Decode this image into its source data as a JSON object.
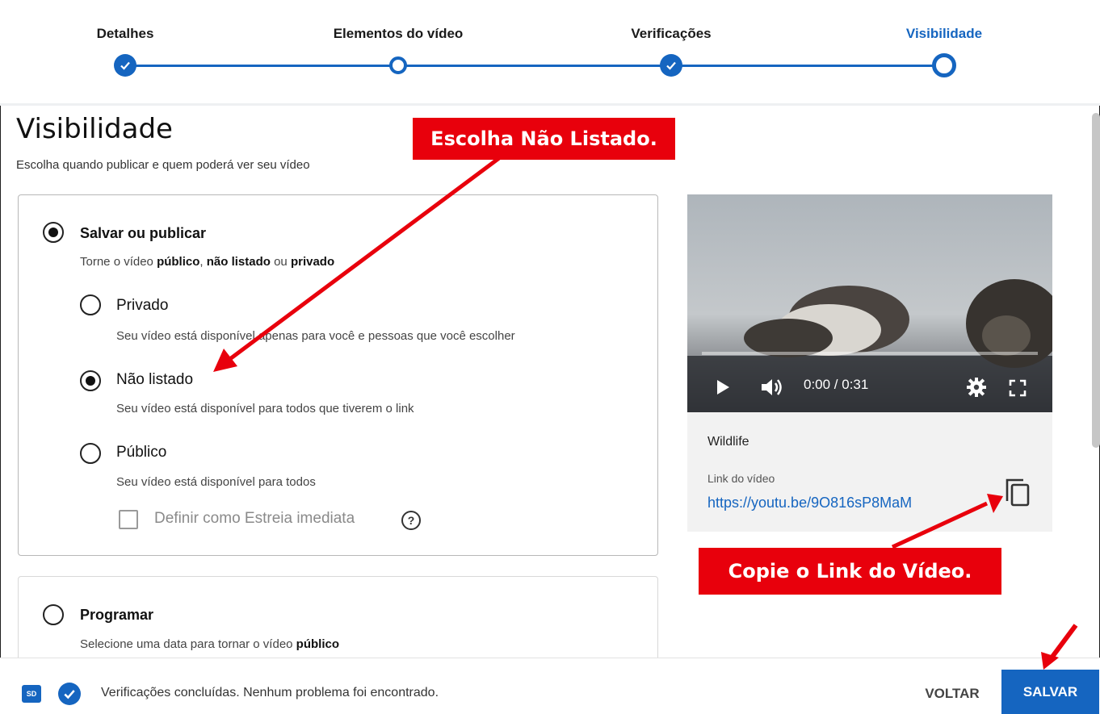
{
  "stepper": {
    "steps": [
      {
        "label": "Detalhes",
        "state": "done"
      },
      {
        "label": "Elementos do vídeo",
        "state": "pending"
      },
      {
        "label": "Verificações",
        "state": "done"
      },
      {
        "label": "Visibilidade",
        "state": "current"
      }
    ],
    "accent_color": "#1565c0"
  },
  "main": {
    "title": "Visibilidade",
    "subtitle": "Escolha quando publicar e quem poderá ver seu vídeo"
  },
  "save_publish": {
    "label": "Salvar ou publicar",
    "selected": true,
    "desc_prefix": "Torne o vídeo ",
    "desc_public": "público",
    "desc_sep1": ", ",
    "desc_unlisted": "não listado",
    "desc_sep2": " ou ",
    "desc_private": "privado",
    "options": [
      {
        "label": "Privado",
        "desc": "Seu vídeo está disponível apenas para você e pessoas que você escolher",
        "selected": false
      },
      {
        "label": "Não listado",
        "desc": "Seu vídeo está disponível para todos que tiverem o link",
        "selected": true
      },
      {
        "label": "Público",
        "desc": "Seu vídeo está disponível para todos",
        "selected": false
      }
    ],
    "premiere": {
      "label": "Definir como Estreia imediata",
      "checked": false,
      "help": "?"
    }
  },
  "schedule": {
    "label": "Programar",
    "selected": false,
    "desc_prefix": "Selecione uma data para tornar o vídeo ",
    "desc_bold": "público"
  },
  "video": {
    "time": "0:00 / 0:31",
    "progress": 0,
    "title": "Wildlife",
    "link_label": "Link do vídeo",
    "link_url": "https://youtu.be/9O816sP8MaM"
  },
  "footer": {
    "badge": "SD",
    "status": "Verificações concluídas. Nenhum problema foi encontrado.",
    "back_label": "VOLTAR",
    "save_label": "SALVAR"
  },
  "annotations": {
    "callout_unlisted": "Escolha Não Listado.",
    "callout_copy": "Copie o Link do Vídeo.",
    "color": "#e8000c"
  }
}
